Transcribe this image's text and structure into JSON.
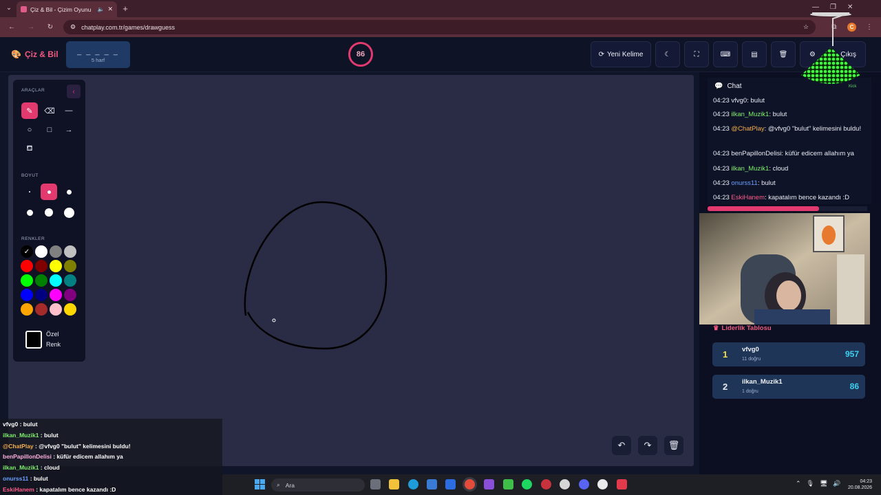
{
  "browser": {
    "tab_title": "Çiz & Bil - Çizim Oyunu",
    "url": "chatplay.com.tr/games/drawguess",
    "profile_initial": "C"
  },
  "header": {
    "logo": "Çiz & Bil",
    "word_mask": "_ _ _ _ _",
    "letter_count": "5 harf",
    "timer": "86",
    "new_word_label": "Yeni Kelime",
    "exit_label": "Çıkış"
  },
  "tools": {
    "section_tools": "ARAÇLAR",
    "section_size": "BOYUT",
    "section_colors": "RENKLER",
    "custom_color_line1": "Özel",
    "custom_color_line2": "Renk",
    "swatches": [
      "#000000",
      "#ffffff",
      "#808080",
      "#c0c0c0",
      "#ff0000",
      "#800000",
      "#ffff00",
      "#808000",
      "#00ff00",
      "#008000",
      "#00ffff",
      "#008080",
      "#0000ff",
      "#000080",
      "#ff00ff",
      "#800080",
      "#ffa500",
      "#a52a2a",
      "#ffc0cb",
      "#ffd700"
    ]
  },
  "chat": {
    "title": "Chat",
    "source": "Kick",
    "messages": [
      {
        "time": "04:23",
        "user": "vfvg0",
        "user_color": "#e8eaf2",
        "text": ": bulut"
      },
      {
        "time": "04:23",
        "user": "ilkan_Muzik1",
        "user_color": "#7cf06a",
        "text": ": bulut"
      },
      {
        "time": "04:23",
        "user": "@ChatPlay",
        "user_color": "#f5b04c",
        "text": ": @vfvg0 \"bulut\" kelimesini buldu!"
      },
      {
        "time": "04:23",
        "user": "benPapillonDelisi",
        "user_color": "#e8eaf2",
        "text": ": küfür edicem allahım ya"
      },
      {
        "time": "04:23",
        "user": "ilkan_Muzik1",
        "user_color": "#7cf06a",
        "text": ": cloud"
      },
      {
        "time": "04:23",
        "user": "onurss11",
        "user_color": "#6aa0ff",
        "text": ": bulut"
      },
      {
        "time": "04:23",
        "user": "EskiHanem",
        "user_color": "#ff5a8a",
        "text": ": kapatalım bence kazandı :D"
      }
    ]
  },
  "leaderboard": {
    "title": "Liderlik Tablosu",
    "rows": [
      {
        "rank": "1",
        "name": "vfvg0",
        "sub": "11 doğru",
        "score": "957"
      },
      {
        "rank": "2",
        "name": "ilkan_Muzik1",
        "sub": "1 doğru",
        "score": "86"
      }
    ]
  },
  "overlay_chat": [
    {
      "user": "vfvg0",
      "color": "#ffffff",
      "text": " : bulut"
    },
    {
      "user": "ilkan_Muzik1",
      "color": "#7cf06a",
      "text": " : bulut"
    },
    {
      "user": "@ChatPlay",
      "color": "#f5b04c",
      "text": " : @vfvg0 \"bulut\" kelimesini buldu!"
    },
    {
      "user": "benPapillonDelisi",
      "color": "#ffb0e0",
      "text": " : küfür edicem allahım ya"
    },
    {
      "user": "ilkan_Muzik1",
      "color": "#7cf06a",
      "text": " : cloud"
    },
    {
      "user": "onurss11",
      "color": "#6aa0ff",
      "text": " : bulut"
    },
    {
      "user": "EskiHanem",
      "color": "#ff5a8a",
      "text": " : kapatalım bence kazandı :D"
    }
  ],
  "taskbar": {
    "search_placeholder": "Ara",
    "time": "04:23",
    "date": "20.08.2026"
  }
}
